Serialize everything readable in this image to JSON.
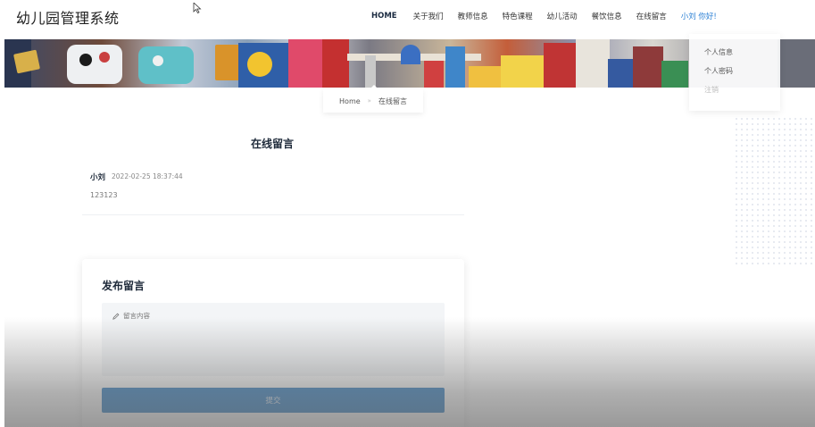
{
  "header": {
    "logo": "幼儿园管理系统",
    "nav": [
      {
        "label": "HOME"
      },
      {
        "label": "关于我们"
      },
      {
        "label": "教师信息"
      },
      {
        "label": "特色课程"
      },
      {
        "label": "幼儿活动"
      },
      {
        "label": "餐饮信息"
      },
      {
        "label": "在线留言"
      },
      {
        "label": "小刘 你好!"
      }
    ]
  },
  "dropdown": {
    "items": [
      {
        "label": "个人信息"
      },
      {
        "label": "个人密码"
      },
      {
        "label": "注销"
      }
    ]
  },
  "breadcrumb": {
    "home": "Home",
    "separator": "»",
    "current": "在线留言"
  },
  "messages": {
    "title": "在线留言",
    "items": [
      {
        "user": "小刘",
        "time": "2022-02-25 18:37:44",
        "content": "123123"
      }
    ]
  },
  "form": {
    "title": "发布留言",
    "content_placeholder": "留言内容",
    "submit_label": "提交"
  },
  "colors": {
    "accent": "#2f7fc4",
    "user_link": "#2a7fd4",
    "heading": "#1e2a3a"
  }
}
